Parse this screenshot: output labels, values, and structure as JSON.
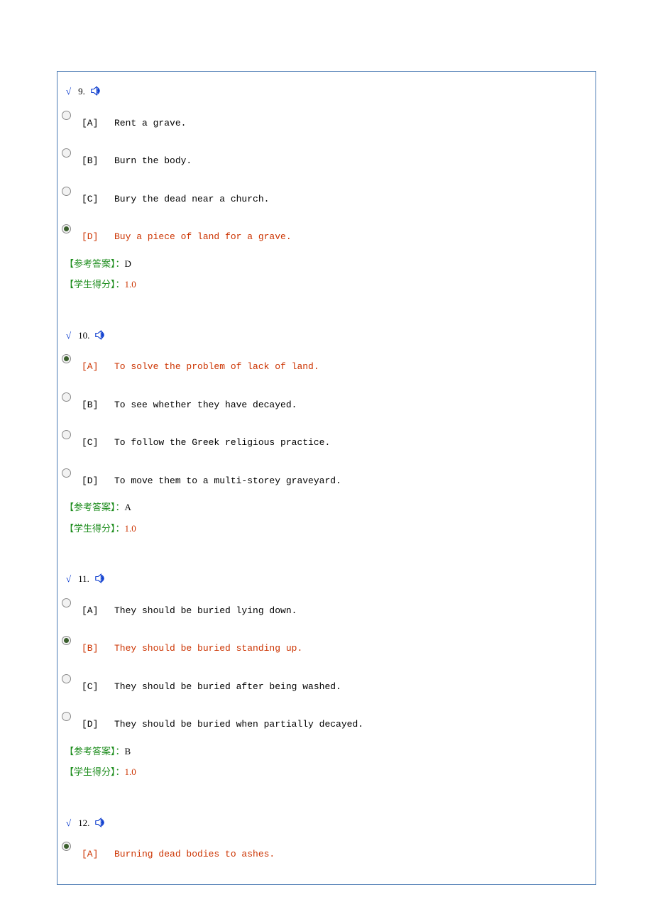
{
  "labels": {
    "correct_mark": "√",
    "answer_label": "【参考答案】：",
    "score_label": "【学生得分】：",
    "score_value": "1.0"
  },
  "questions": [
    {
      "number": "9.",
      "selected": "D",
      "correct_answer": "D",
      "options": [
        {
          "key": "[A]",
          "text": "Rent a grave."
        },
        {
          "key": "[B]",
          "text": "Burn the body."
        },
        {
          "key": "[C]",
          "text": "Bury the dead near a church."
        },
        {
          "key": "[D]",
          "text": "Buy a piece of land for a grave."
        }
      ]
    },
    {
      "number": "10.",
      "selected": "A",
      "correct_answer": "A",
      "options": [
        {
          "key": "[A]",
          "text": "To solve the problem of lack of land."
        },
        {
          "key": "[B]",
          "text": "To see whether they have decayed."
        },
        {
          "key": "[C]",
          "text": "To follow the Greek religious practice."
        },
        {
          "key": "[D]",
          "text": "To move them to a multi-storey graveyard."
        }
      ]
    },
    {
      "number": "11.",
      "selected": "B",
      "correct_answer": "B",
      "options": [
        {
          "key": "[A]",
          "text": "They should be buried lying down."
        },
        {
          "key": "[B]",
          "text": "They should be buried standing up."
        },
        {
          "key": "[C]",
          "text": "They should be buried after being washed."
        },
        {
          "key": "[D]",
          "text": "They should be buried when partially decayed."
        }
      ]
    },
    {
      "number": "12.",
      "selected": "A",
      "correct_answer": null,
      "options": [
        {
          "key": "[A]",
          "text": "Burning dead bodies to ashes."
        }
      ]
    }
  ]
}
